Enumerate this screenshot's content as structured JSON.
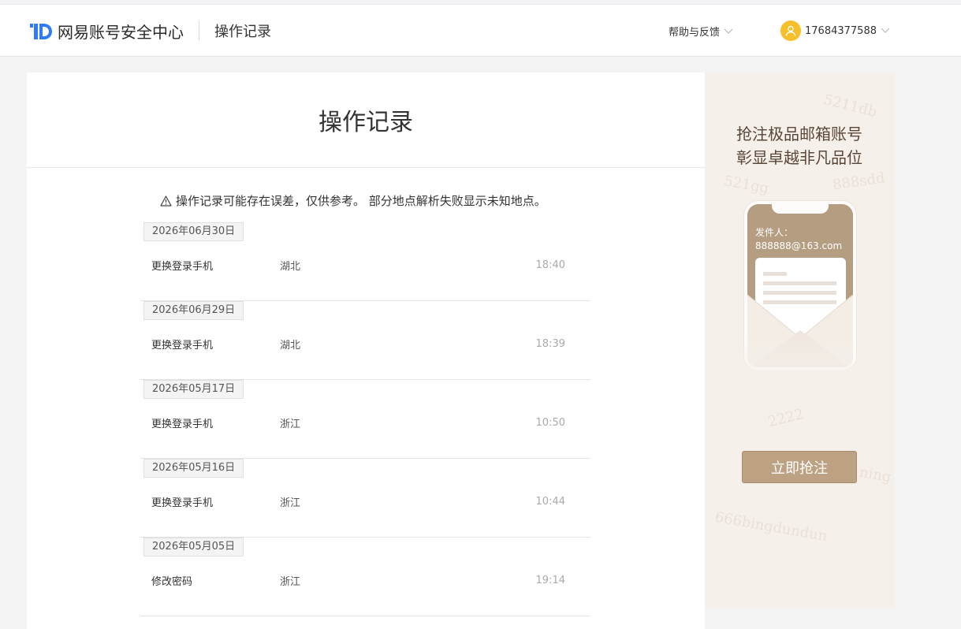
{
  "header": {
    "brand": "网易账号安全中心",
    "page_name": "操作记录",
    "help_label": "帮助与反馈",
    "username": "17684377588"
  },
  "main": {
    "title": "操作记录",
    "notice": "操作记录可能存在误差，仅供参考。 部分地点解析失败显示未知地点。",
    "records": [
      {
        "date": "2026年06月30日",
        "action": "更换登录手机",
        "place": "湖北",
        "time": "18:40"
      },
      {
        "date": "2026年06月29日",
        "action": "更换登录手机",
        "place": "湖北",
        "time": "18:39"
      },
      {
        "date": "2026年05月17日",
        "action": "更换登录手机",
        "place": "浙江",
        "time": "10:50"
      },
      {
        "date": "2026年05月16日",
        "action": "更换登录手机",
        "place": "浙江",
        "time": "10:44"
      },
      {
        "date": "2026年05月05日",
        "action": "修改密码",
        "place": "浙江",
        "time": "19:14"
      }
    ]
  },
  "ad": {
    "title_line1": "抢注极品邮箱账号",
    "title_line2": "彰显卓越非凡品位",
    "sender_label": "发件人：",
    "sender_email": "888888@163.com",
    "button_label": "立即抢注",
    "bg_words": [
      "5211db",
      "2222",
      "666bingdundun",
      "888sdd",
      "ning",
      "521gg"
    ]
  },
  "colors": {
    "brand_blue": "#2f7cf6",
    "avatar_yellow": "#f7bf2a",
    "ad_gold": "#bda183"
  },
  "icons": {
    "logo": "netease-id-logo",
    "chevron": "chevron-down-icon",
    "user": "user-icon",
    "warning": "warning-icon"
  }
}
